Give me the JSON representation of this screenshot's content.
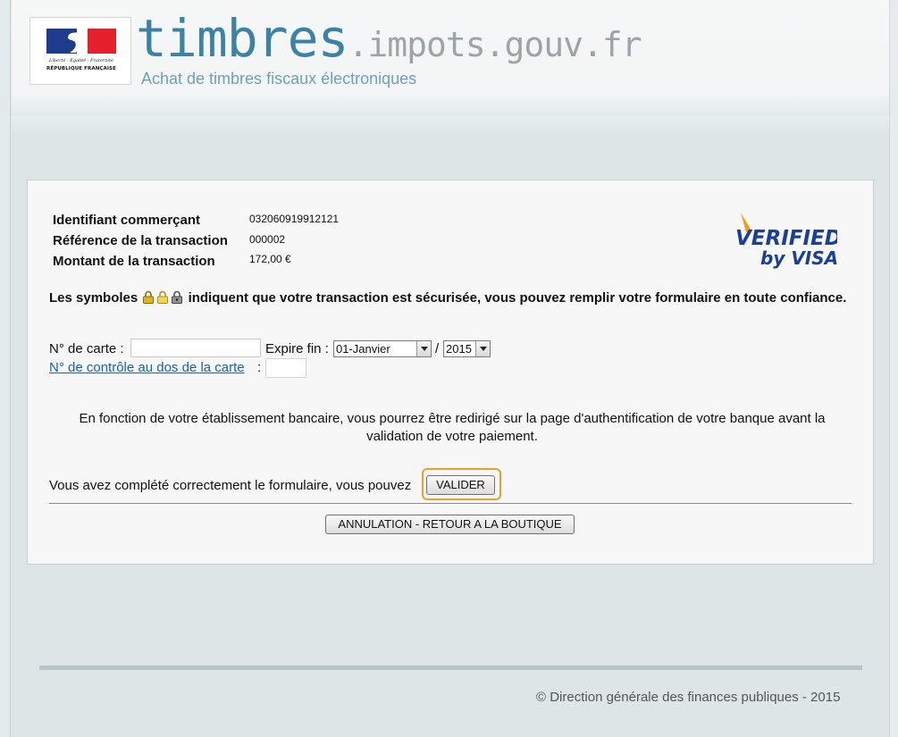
{
  "header": {
    "logo_motto": "Liberté · Égalité · Fraternité",
    "logo_republic": "RÉPUBLIQUE FRANÇAISE",
    "title_main": "timbres",
    "title_domain": ".impots.gouv.fr",
    "subtitle": "Achat de timbres fiscaux électroniques"
  },
  "transaction": {
    "merchant_label": "Identifiant commerçant",
    "merchant_value": "032060919912121",
    "reference_label": "Référence de la transaction",
    "reference_value": "000002",
    "amount_label": "Montant de la transaction",
    "amount_value": "172,00 €"
  },
  "visa": {
    "line1": "VERIFIED",
    "line2": "by VISA"
  },
  "security": {
    "prefix": "Les symboles",
    "suffix": "indiquent que votre transaction est sécurisée, vous pouvez remplir votre formulaire en toute confiance.",
    "lock_color": "#d4a017"
  },
  "form": {
    "card_label": "N° de carte :",
    "card_value": "",
    "expire_label": "Expire fin :",
    "month_selected": "01-Janvier",
    "separator": "/",
    "year_selected": "2015",
    "control_link": "N° de contrôle au dos de la carte",
    "control_colon": ":",
    "control_value": ""
  },
  "bank_notice": "En fonction de votre établissement bancaire, vous pourrez être redirigé sur la page d'authentification de votre banque avant la validation de votre paiement.",
  "actions": {
    "complete_text": "Vous avez complété correctement le formulaire, vous pouvez",
    "valider_label": "VALIDER",
    "cancel_label": "ANNULATION - RETOUR A LA BOUTIQUE",
    "highlight_color": "#f0a028"
  },
  "footer": {
    "copyright": "© Direction générale des finances publiques - 2015"
  }
}
